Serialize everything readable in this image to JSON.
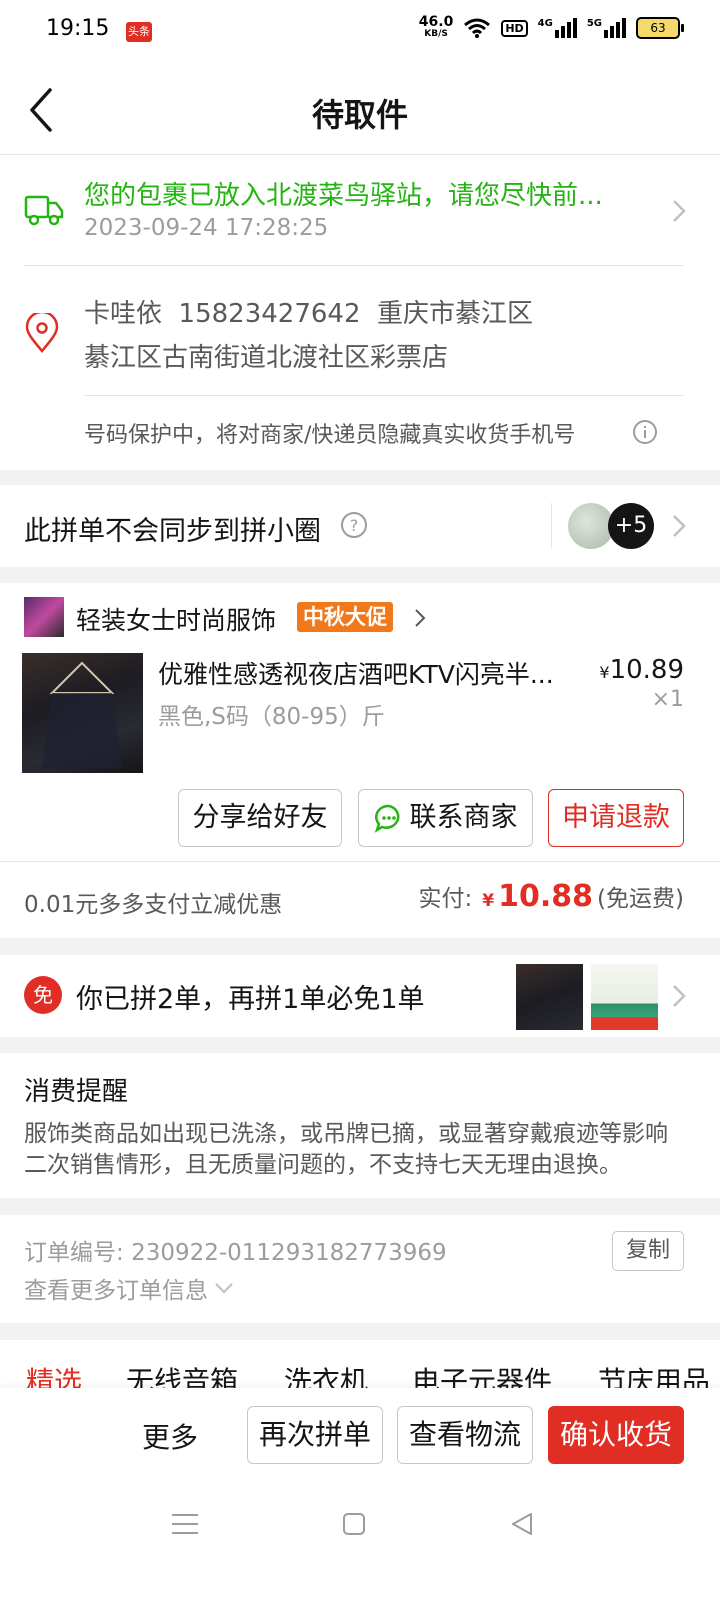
{
  "status_bar": {
    "time": "19:15",
    "app_badge": "头条",
    "net_speed_value": "46.0",
    "net_speed_unit": "KB/S",
    "hd": "HD",
    "sig1": "4G",
    "sig2": "5G",
    "battery": "63"
  },
  "header": {
    "title": "待取件"
  },
  "logistics": {
    "message": "您的包裹已放入北渡菜鸟驿站，请您尽快前...",
    "time": "2023-09-24 17:28:25"
  },
  "address": {
    "name": "卡哇依",
    "phone": "15823427642",
    "region": "重庆市綦江区",
    "detail": "綦江区古南街道北渡社区彩票店",
    "privacy_note": "号码保护中，将对商家/快递员隐藏真实收货手机号"
  },
  "circle": {
    "text": "此拼单不会同步到拼小圈",
    "count": "+5"
  },
  "order": {
    "store_name": "轻装女士时尚服饰",
    "promo_tag": "中秋大促",
    "product_title": "优雅性感透视夜店酒吧KTV闪亮半...",
    "product_spec": "黑色,S码（80-95）斤",
    "currency": "¥",
    "price": "10.89",
    "quantity": "×1",
    "btn_share": "分享给好友",
    "btn_contact": "联系商家",
    "btn_refund": "申请退款",
    "discount_note": "0.01元多多支付立减优惠",
    "paid_label": "实付:",
    "paid_amount": "10.88",
    "shipping": "(免运费)"
  },
  "free_order": {
    "badge": "免",
    "text": "你已拼2单，再拼1单必免1单"
  },
  "reminder": {
    "title": "消费提醒",
    "body": "服饰类商品如出现已洗涤，或吊牌已摘，或显著穿戴痕迹等影响二次销售情形，且无质量问题的，不支持七天无理由退换。"
  },
  "order_info": {
    "label": "订单编号:",
    "number": "230922-011293182773969",
    "copy": "复制",
    "more": "查看更多订单信息"
  },
  "categories": [
    "精选",
    "无线音箱",
    "洗衣机",
    "电子元器件",
    "节庆用品"
  ],
  "bottom_actions": {
    "more": "更多",
    "reorder": "再次拼单",
    "logistics": "查看物流",
    "confirm": "确认收货"
  },
  "colors": {
    "brand_red": "#e02e24",
    "success_green": "#25b513",
    "promo_orange": "#f2791b"
  }
}
